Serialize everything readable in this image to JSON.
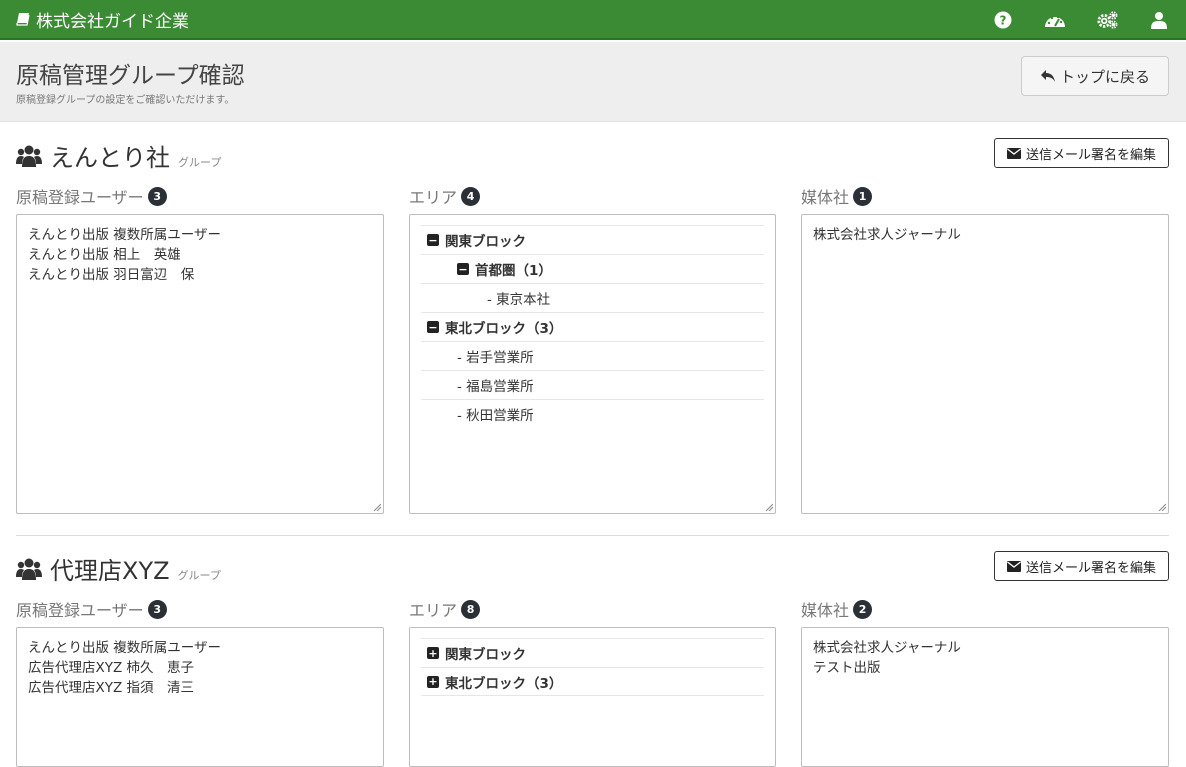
{
  "navbar": {
    "brand": "株式会社ガイド企業",
    "icons": [
      "help-icon",
      "dashboard-icon",
      "settings-icon",
      "user-icon"
    ]
  },
  "header": {
    "title": "原稿管理グループ確認",
    "subtitle": "原稿登録グループの設定をご確認いただけます。",
    "back_label": "トップに戻る"
  },
  "groups": [
    {
      "name": "えんとり社",
      "suffix": "グループ",
      "edit_label": "送信メール署名を編集",
      "users": {
        "label": "原稿登録ユーザー",
        "count": "3",
        "items": [
          "えんとり出版 複数所属ユーザー",
          "えんとり出版 相上　英雄",
          "えんとり出版 羽日富辺　保"
        ]
      },
      "areas": {
        "label": "エリア",
        "count": "4",
        "rows": [
          {
            "text": "関東ブロック",
            "toggle": "−",
            "bold": true,
            "level": 0
          },
          {
            "text": "首都圏（1）",
            "toggle": "−",
            "bold": true,
            "level": 1
          },
          {
            "text": "- 東京本社",
            "toggle": "",
            "bold": false,
            "level": 2
          },
          {
            "text": "東北ブロック（3）",
            "toggle": "−",
            "bold": true,
            "level": 0
          },
          {
            "text": "- 岩手営業所",
            "toggle": "",
            "bold": false,
            "level": 1
          },
          {
            "text": "- 福島営業所",
            "toggle": "",
            "bold": false,
            "level": 1
          },
          {
            "text": "- 秋田営業所",
            "toggle": "",
            "bold": false,
            "level": 1
          }
        ]
      },
      "media": {
        "label": "媒体社",
        "count": "1",
        "items": [
          "株式会社求人ジャーナル"
        ]
      }
    },
    {
      "name": "代理店XYZ",
      "suffix": "グループ",
      "edit_label": "送信メール署名を編集",
      "users": {
        "label": "原稿登録ユーザー",
        "count": "3",
        "items": [
          "えんとり出版 複数所属ユーザー",
          "広告代理店XYZ 柿久　恵子",
          "広告代理店XYZ 指須　清三"
        ]
      },
      "areas": {
        "label": "エリア",
        "count": "8",
        "rows": [
          {
            "text": "関東ブロック",
            "toggle": "+",
            "bold": true,
            "level": 0
          },
          {
            "text": "東北ブロック（3）",
            "toggle": "+",
            "bold": true,
            "level": 0
          }
        ]
      },
      "media": {
        "label": "媒体社",
        "count": "2",
        "items": [
          "株式会社求人ジャーナル",
          "テスト出版"
        ]
      }
    }
  ]
}
